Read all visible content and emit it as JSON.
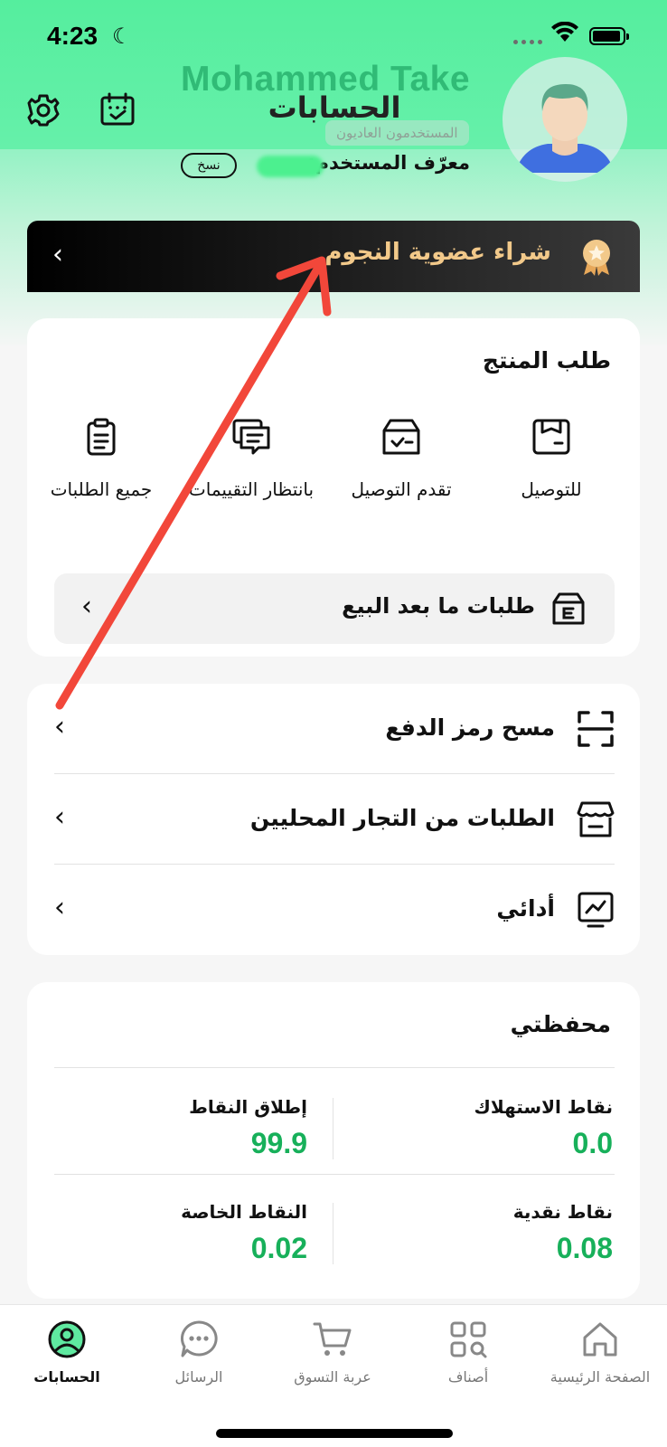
{
  "status_bar": {
    "time": "4:23"
  },
  "header": {
    "username": "Mohammed Take",
    "title": "الحسابات",
    "user_type_badge": "المستخدمون العاديون",
    "user_id_label": "معرّف المستخدم:",
    "copy_label": "نسخ"
  },
  "vip_banner": {
    "label": "شراء عضوية النجوم"
  },
  "orders": {
    "title": "طلب المنتج",
    "items": [
      {
        "label": "للتوصيل",
        "icon": "pending-delivery-icon"
      },
      {
        "label": "تقدم التوصيل",
        "icon": "delivery-progress-icon"
      },
      {
        "label": "بانتظار التقييمات",
        "icon": "pending-reviews-icon"
      },
      {
        "label": "جميع الطلبات",
        "icon": "all-orders-icon"
      }
    ],
    "aftersale_label": "طلبات ما بعد البيع"
  },
  "menu": [
    {
      "label": "مسح رمز الدفع",
      "icon": "scan-icon"
    },
    {
      "label": "الطلبات من التجار المحليين",
      "icon": "store-icon"
    },
    {
      "label": "أدائي",
      "icon": "performance-icon"
    }
  ],
  "wallet": {
    "title": "محفظتي",
    "consumption_points_label": "نقاط الاستهلاك",
    "consumption_points_value": "0.0",
    "release_points_label": "إطلاق النقاط",
    "release_points_value": "99.9",
    "cash_points_label": "نقاط نقدية",
    "cash_points_value": "0.08",
    "special_points_label": "النقاط الخاصة",
    "special_points_value": "0.02"
  },
  "tabbar": {
    "home": "الصفحة الرئيسية",
    "categories": "أصناف",
    "cart": "عربة التسوق",
    "messages": "الرسائل",
    "accounts": "الحسابات"
  },
  "colors": {
    "accent_green": "#17b05a",
    "header_green": "#55ee9e",
    "vip_gold": "#f2c98a",
    "annotation_red": "#f2473a"
  }
}
